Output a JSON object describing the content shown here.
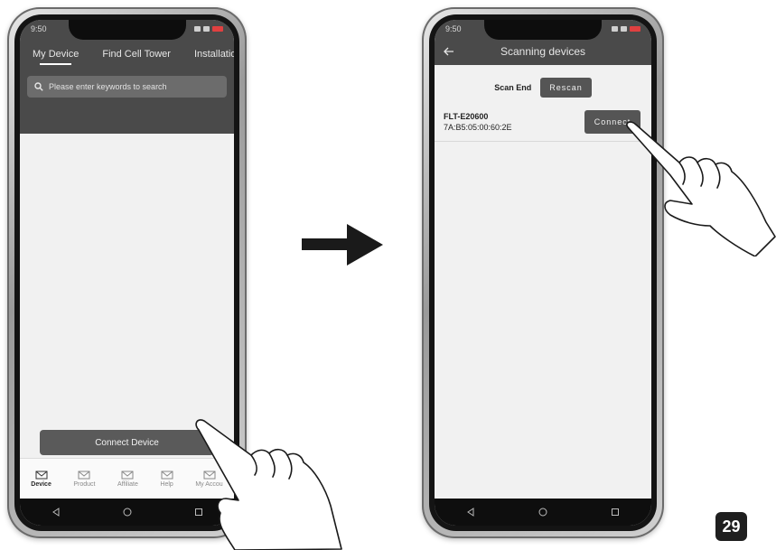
{
  "left_phone": {
    "status_time": "9:50",
    "tabs": [
      {
        "label": "My Device"
      },
      {
        "label": "Find Cell Tower"
      },
      {
        "label": "Installation Video"
      }
    ],
    "search_placeholder": "Please enter keywords to search",
    "connect_button": "Connect Device",
    "nav_items": [
      {
        "label": "Device",
        "icon": "mail-icon"
      },
      {
        "label": "Product",
        "icon": "mail-icon"
      },
      {
        "label": "Affiliate",
        "icon": "mail-icon"
      },
      {
        "label": "Help",
        "icon": "mail-icon"
      },
      {
        "label": "My Accou",
        "icon": "mail-icon"
      }
    ]
  },
  "right_phone": {
    "status_time": "9:50",
    "title": "Scanning devices",
    "scan_status": "Scan End",
    "rescan_button": "Rescan",
    "device": {
      "name": "FLT-E20600",
      "mac": "7A:B5:05:00:60:2E",
      "connect_button": "Connect"
    }
  },
  "page_number": "29",
  "colors": {
    "header_bg": "#4a4a4a",
    "button_bg": "#555555",
    "screen_bg": "#f1f1f1",
    "badge_bg": "#1f1f1f"
  }
}
